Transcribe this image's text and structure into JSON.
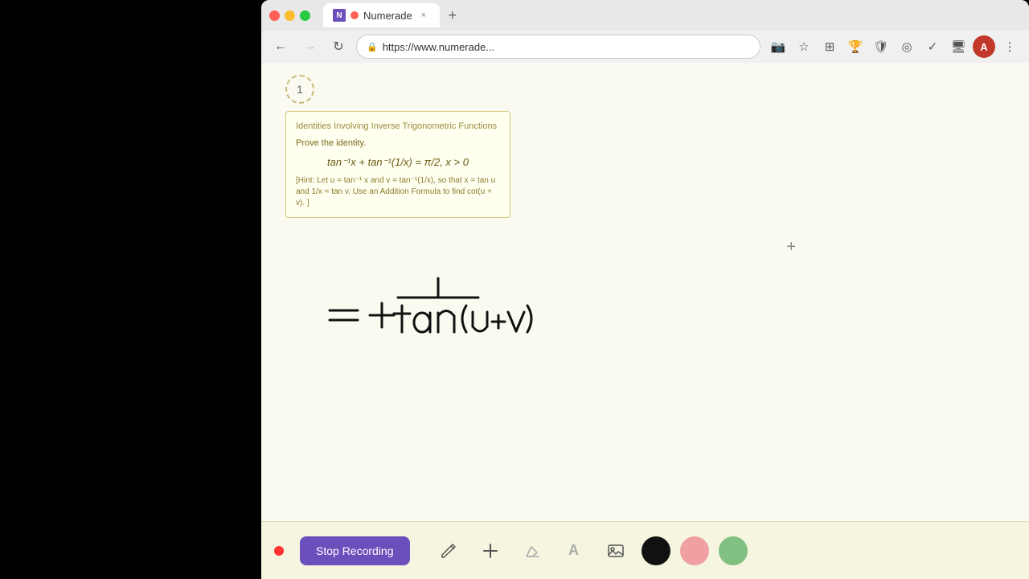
{
  "browser": {
    "tab_title": "Numerade",
    "tab_favicon_letter": "N",
    "address": "https://www.numerade...",
    "avatar_letter": "A",
    "new_tab_symbol": "+"
  },
  "nav": {
    "back": "←",
    "forward": "→",
    "refresh": "↻"
  },
  "content": {
    "step_number": "1",
    "problem_title": "Identities Involving Inverse Trigonometric Functions",
    "problem_subtitle": "Prove the identity.",
    "formula_display": "tan⁻¹x + tan⁻¹(1/x) = π/2,  x > 0",
    "hint_text": "[Hint: Let u = tan⁻¹ x and v = tan⁻¹(1/x), so that x = tan u and 1/x = tan v. Use an Addition Formula to find cot(u + v). ]",
    "handwritten_math": "= + tan(u+v)",
    "plus_symbol": "+"
  },
  "toolbar": {
    "stop_recording_label": "Stop Recording",
    "pencil_tool": "✏",
    "plus_tool": "+",
    "eraser_tool": "⌫",
    "text_tool": "A",
    "image_tool": "🖼",
    "colors": {
      "black": "#111111",
      "pink": "#f0a0a0",
      "green": "#80c080"
    }
  }
}
